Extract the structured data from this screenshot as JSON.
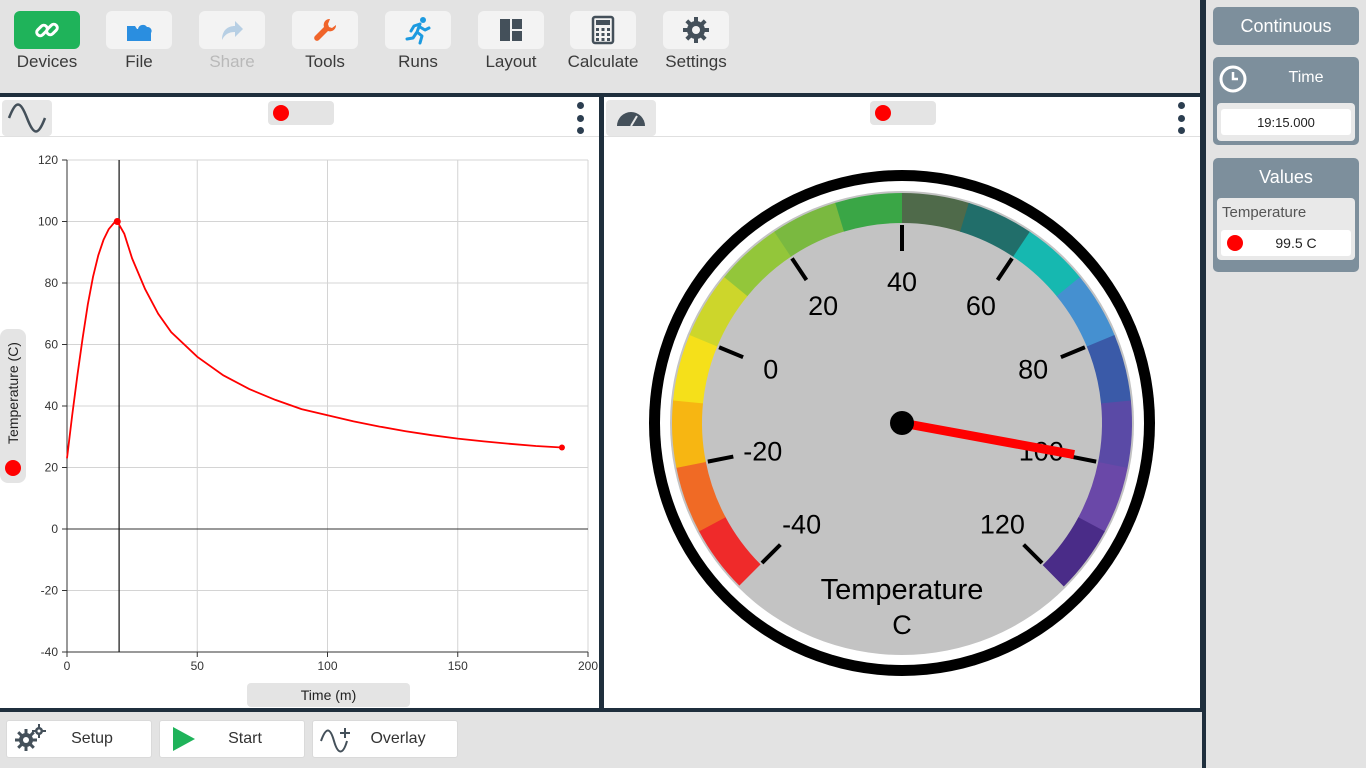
{
  "toolbar": {
    "devices": "Devices",
    "file": "File",
    "share": "Share",
    "tools": "Tools",
    "runs": "Runs",
    "layout": "Layout",
    "calculate": "Calculate",
    "settings": "Settings"
  },
  "bottom": {
    "setup": "Setup",
    "start": "Start",
    "overlay": "Overlay"
  },
  "sidebar": {
    "mode": "Continuous",
    "time_label": "Time",
    "time_value": "19:15.000",
    "values_label": "Values",
    "sensor_label": "Temperature",
    "sensor_value": "99.5 C"
  },
  "colors": {
    "series": "#ff0000",
    "accent_dark": "#1f2f3d",
    "sidebar_head": "#7d8f9c",
    "devices_green": "#1fb35a"
  },
  "chart_data": {
    "type": "line",
    "xlabel": "Time (m)",
    "ylabel": "Temperature (C)",
    "xlim": [
      0,
      200
    ],
    "ylim": [
      -40,
      120
    ],
    "xticks": [
      0,
      50,
      100,
      150,
      200
    ],
    "yticks": [
      120,
      100,
      80,
      60,
      40,
      20,
      0,
      -20,
      -40
    ],
    "cursor_x": 20,
    "grid": true,
    "series": [
      {
        "color": "#ff0000",
        "x": [
          0,
          2,
          4,
          6,
          8,
          10,
          12,
          14,
          16,
          18,
          19.3,
          22,
          25,
          30,
          35,
          40,
          50,
          60,
          70,
          80,
          90,
          100,
          110,
          120,
          130,
          140,
          150,
          160,
          170,
          180,
          190
        ],
        "y": [
          23,
          37,
          50,
          62,
          73,
          82,
          89,
          94,
          97.5,
          99.5,
          100,
          96,
          88,
          78,
          70,
          64,
          56,
          50,
          45.5,
          42,
          39,
          37,
          35,
          33.3,
          31.8,
          30.5,
          29.4,
          28.5,
          27.7,
          27,
          26.5
        ]
      }
    ]
  },
  "gauge": {
    "title": "Temperature",
    "unit": "C",
    "min": -40,
    "max": 120,
    "value": 99.5,
    "tick_labels": [
      "-40",
      "-20",
      "0",
      "20",
      "40",
      "60",
      "80",
      "100",
      "120"
    ]
  }
}
